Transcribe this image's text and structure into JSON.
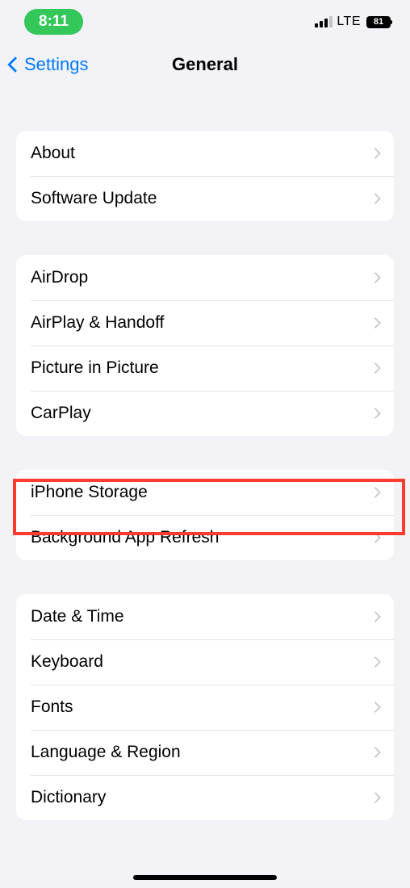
{
  "status_bar": {
    "time": "8:11",
    "network": "LTE",
    "battery_percent": "81"
  },
  "nav": {
    "back_label": "Settings",
    "title": "General"
  },
  "groups": [
    {
      "items": [
        {
          "label": "About"
        },
        {
          "label": "Software Update"
        }
      ]
    },
    {
      "items": [
        {
          "label": "AirDrop"
        },
        {
          "label": "AirPlay & Handoff"
        },
        {
          "label": "Picture in Picture"
        },
        {
          "label": "CarPlay"
        }
      ]
    },
    {
      "items": [
        {
          "label": "iPhone Storage",
          "highlighted": true
        },
        {
          "label": "Background App Refresh"
        }
      ]
    },
    {
      "items": [
        {
          "label": "Date & Time"
        },
        {
          "label": "Keyboard"
        },
        {
          "label": "Fonts"
        },
        {
          "label": "Language & Region"
        },
        {
          "label": "Dictionary"
        }
      ]
    }
  ]
}
